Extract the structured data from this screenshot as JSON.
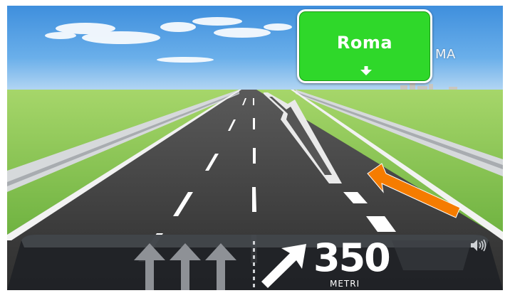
{
  "sign": {
    "destination": "Roma",
    "arrow_icon": "down-arrow-icon",
    "color": "#2fd82a"
  },
  "city_label": "MA",
  "instruction": {
    "distance": "350",
    "unit": "METRI",
    "turn_icon": "bear-right-arrow-icon",
    "lanes": [
      "straight",
      "straight",
      "straight",
      "bear-right"
    ]
  },
  "volume_icon": "speaker-icon",
  "colors": {
    "sky": "#4e9ae0",
    "grass": "#6bbb3c",
    "road": "#3a3a3a",
    "turn_arrow": "#f57c00"
  }
}
